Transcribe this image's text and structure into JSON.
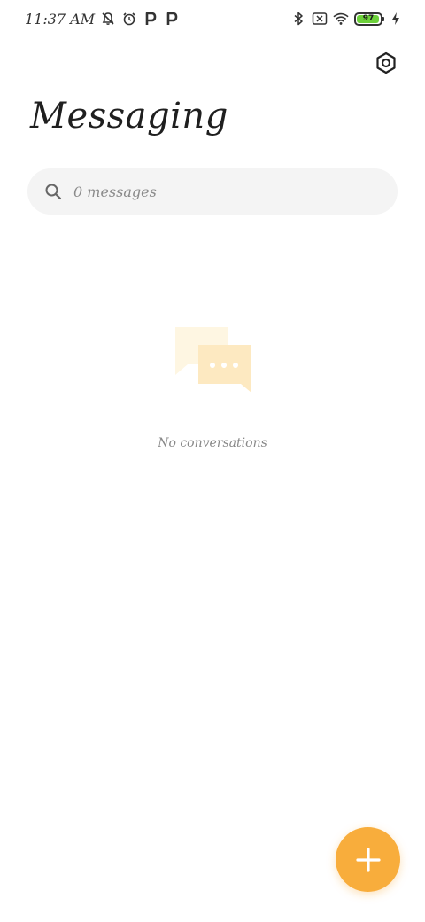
{
  "status_bar": {
    "time": "11:37 AM",
    "battery_level": "97",
    "battery_fraction": 0.97,
    "left_icons": [
      "notifications-off-icon",
      "alarm-icon",
      "parking-app-icon",
      "parking-app-icon"
    ],
    "right_icons": [
      "bluetooth-icon",
      "no-sim-icon",
      "wifi-icon",
      "battery-icon",
      "charging-icon"
    ]
  },
  "header": {
    "title": "Messaging",
    "settings_icon": "gear-icon"
  },
  "search": {
    "placeholder": "0 messages",
    "value": ""
  },
  "empty_state": {
    "illustration": "chat-bubbles-icon",
    "message": "No conversations"
  },
  "fab": {
    "icon": "plus-icon"
  },
  "colors": {
    "accent": "#f8ad3c",
    "search_background": "#f4f4f4",
    "illustration_back": "#fef6e2",
    "illustration_front": "#fde9c1",
    "battery_fill": "#6dd13b"
  }
}
